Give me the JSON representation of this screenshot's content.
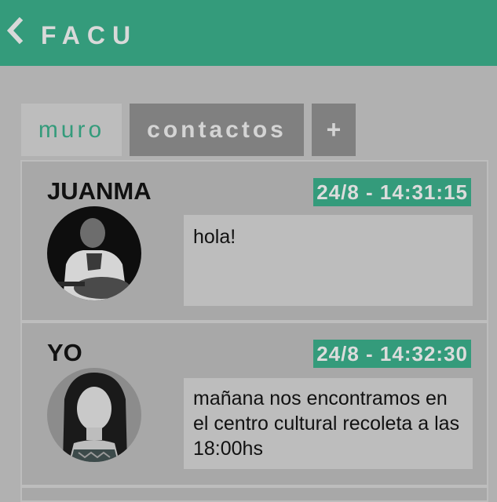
{
  "header": {
    "title": "FACU",
    "back_icon": "chevron-left-icon",
    "background": "#349b7b"
  },
  "tabs": [
    {
      "label": "muro",
      "active": true
    },
    {
      "label": "contactos",
      "active": false
    },
    {
      "label": "+",
      "active": false
    }
  ],
  "posts": [
    {
      "author": "JUANMA",
      "timestamp": "24/8 - 14:31:15",
      "message": "hola!"
    },
    {
      "author": "YO",
      "timestamp": "24/8 - 14:32:30",
      "message": "mañana nos encontramos en el centro cultural recoleta a las 18:00hs"
    }
  ],
  "colors": {
    "accent": "#349b7b",
    "background": "#b1b1b1",
    "card": "#a8a8a8",
    "message_box": "#bdbdbd",
    "tab_inactive": "#808080"
  }
}
